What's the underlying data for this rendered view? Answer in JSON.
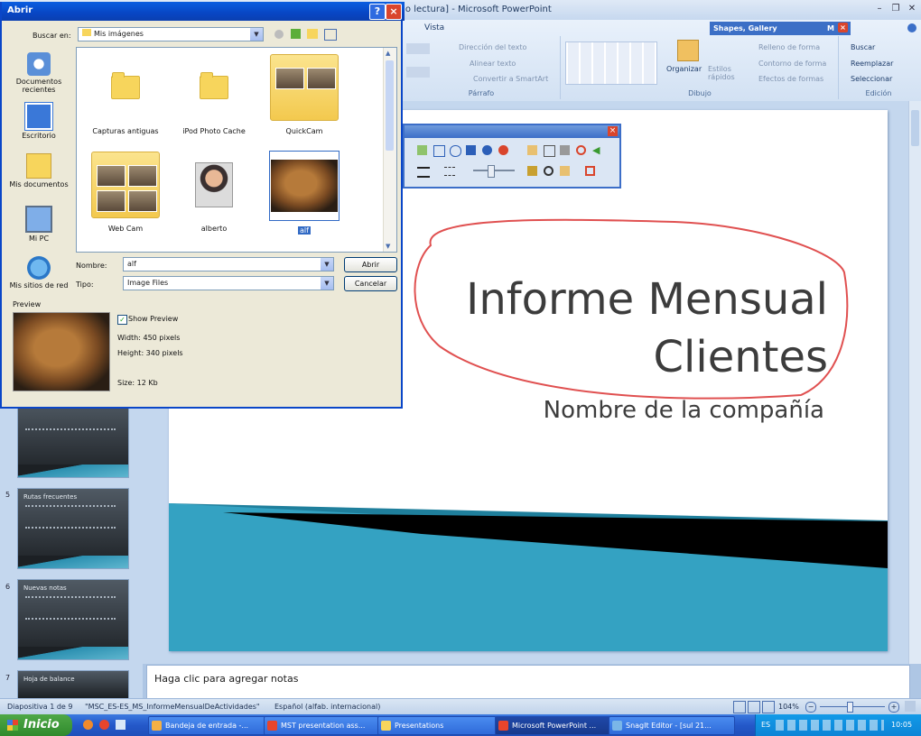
{
  "ppt": {
    "title": "ólo lectura] - Microsoft PowerPoint",
    "tab_vista": "Vista",
    "shapes_gallery": "Shapes, Gallery",
    "shapes_gallery_m": "M",
    "groups": {
      "parrafo": "Párrafo",
      "dibujo": "Dibujo",
      "edicion": "Edición"
    },
    "ribbon": {
      "direccion": "Dirección del texto",
      "alinear": "Alinear texto",
      "smartart": "Convertir a SmartArt",
      "organizar": "Organizar",
      "estilos": "Estilos rápidos",
      "relleno": "Relleno de forma",
      "contorno": "Contorno de forma",
      "efectos": "Efectos de formas",
      "buscar": "Buscar",
      "reemplazar": "Reemplazar",
      "seleccionar": "Seleccionar"
    },
    "slide": {
      "title_line1": "Informe Mensual",
      "title_line2": "Clientes",
      "subtitle": "Nombre de la compañía"
    },
    "thumbnails": [
      {
        "num": "",
        "title": ""
      },
      {
        "num": "5",
        "title": "Rutas frecuentes"
      },
      {
        "num": "6",
        "title": "Nuevas notas"
      },
      {
        "num": "7",
        "title": "Hoja de balance"
      }
    ],
    "notes_placeholder": "Haga clic para agregar notas",
    "status": {
      "slide": "Diapositiva 1 de 9",
      "file": "\"MSC_ES-ES_MS_InformeMensualDeActividades\"",
      "lang": "Español (alfab. internacional)",
      "zoom": "104%"
    }
  },
  "dialog": {
    "title": "Abrir",
    "buscar_en_label": "Buscar en:",
    "buscar_en_value": "Mis imágenes",
    "places": [
      "Documentos recientes",
      "Escritorio",
      "Mis documentos",
      "Mi PC",
      "Mis sitios de red"
    ],
    "files": [
      "Capturas antiguas",
      "iPod Photo Cache",
      "QuickCam",
      "Web Cam",
      "alberto",
      "alf"
    ],
    "nombre_label": "Nombre:",
    "nombre_value": "alf",
    "tipo_label": "Tipo:",
    "tipo_value": "Image Files",
    "abrir_btn": "Abrir",
    "cancelar_btn": "Cancelar",
    "preview_label": "Preview",
    "show_preview": "Show Preview",
    "width": "Width: 450 pixels",
    "height": "Height: 340 pixels",
    "size": "Size: 12 Kb"
  },
  "taskbar": {
    "start": "Inicio",
    "tasks": [
      "Bandeja de entrada -...",
      "MST presentation ass...",
      "Presentations",
      "Microsoft PowerPoint ...",
      "SnagIt Editor - [sul 21..."
    ],
    "lang": "ES",
    "clock": "10:05"
  },
  "colors": {
    "accent": "#0a46c8",
    "slide_wave": "#2b8fb0",
    "annotation": "#e05050"
  }
}
